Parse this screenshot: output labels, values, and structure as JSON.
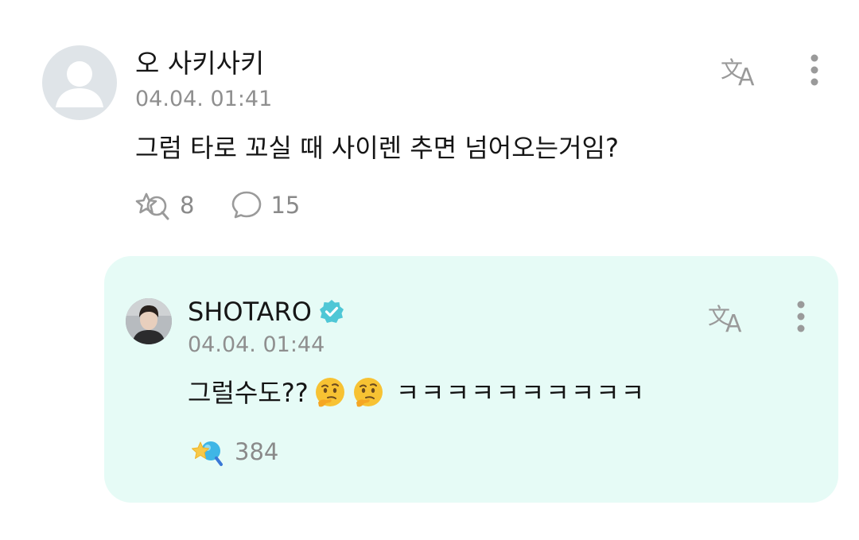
{
  "comment": {
    "author": "오 사키사키",
    "timestamp": "04.04. 01:41",
    "body": "그럼 타로 꼬실 때 사이렌 추면 넘어오는거임?",
    "like_count": "8",
    "reply_count": "15",
    "icons": {
      "avatar": "default-user-avatar",
      "translate": "translate-icon",
      "more": "more-vertical-icon",
      "like": "cheer-icon",
      "reply": "comment-bubble-icon"
    }
  },
  "reply": {
    "author": "SHOTARO",
    "timestamp": "04.04. 01:44",
    "body_text": "그럴수도??",
    "emoji": [
      "thinking-face",
      "thinking-face"
    ],
    "body_laugh": "ㅋㅋㅋㅋㅋㅋㅋㅋㅋㅋ",
    "like_count": "384",
    "icons": {
      "verified": "verified-badge-icon",
      "translate": "translate-icon",
      "more": "more-vertical-icon",
      "like": "cheer-active-icon"
    }
  },
  "colors": {
    "reply_background": "#e6fbf6",
    "verified_badge": "#4fc7d6",
    "meta_text": "#8f8f8f",
    "icon_gray": "#9a9a9a"
  }
}
